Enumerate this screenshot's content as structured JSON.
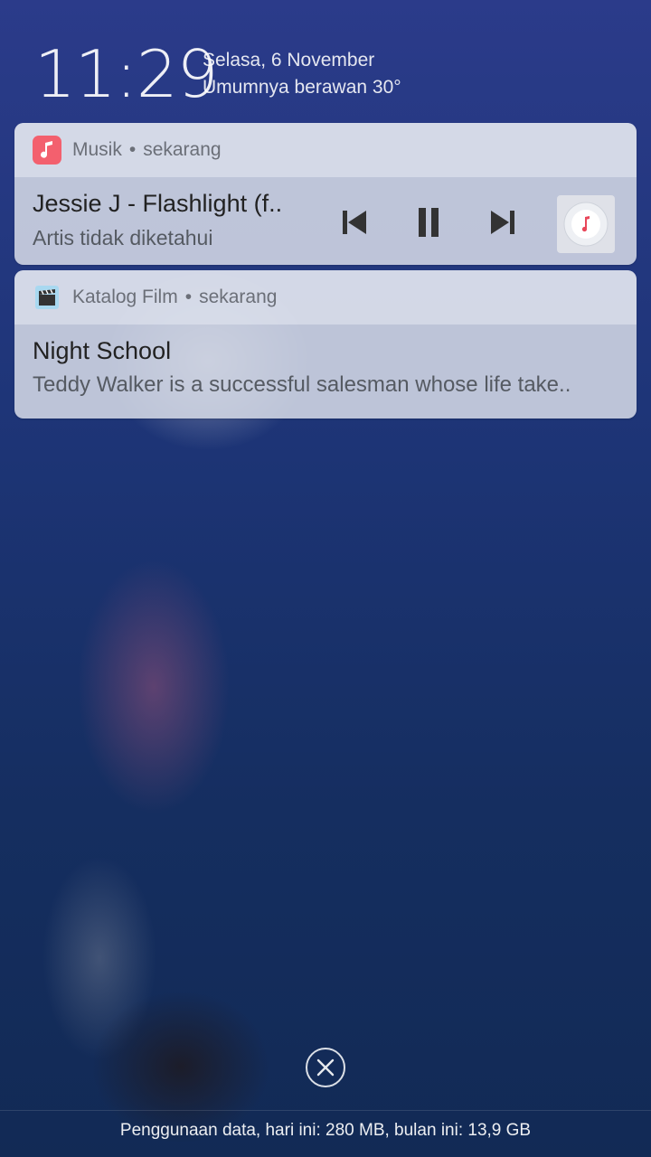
{
  "header": {
    "time": "11:29",
    "date": "Selasa, 6 November",
    "weather": "Umumnya berawan 30°"
  },
  "notifications": [
    {
      "app": "Musik",
      "when": "sekarang",
      "icon": "music-note-icon",
      "title": "Jessie J - Flashlight (f..",
      "subtitle": "Artis tidak diketahui",
      "controls": [
        "previous-icon",
        "pause-icon",
        "next-icon"
      ]
    },
    {
      "app": "Katalog Film",
      "when": "sekarang",
      "icon": "clapperboard-icon",
      "title": "Night School",
      "subtitle": "Teddy Walker is a successful salesman whose life take.."
    }
  ],
  "footer": {
    "data_usage": "Penggunaan data, hari ini: 280 MB, bulan ini: 13,9 GB"
  },
  "colors": {
    "music_accent": "#f3606e",
    "background_top": "#2b3b8a",
    "background_bottom": "#122a55"
  }
}
